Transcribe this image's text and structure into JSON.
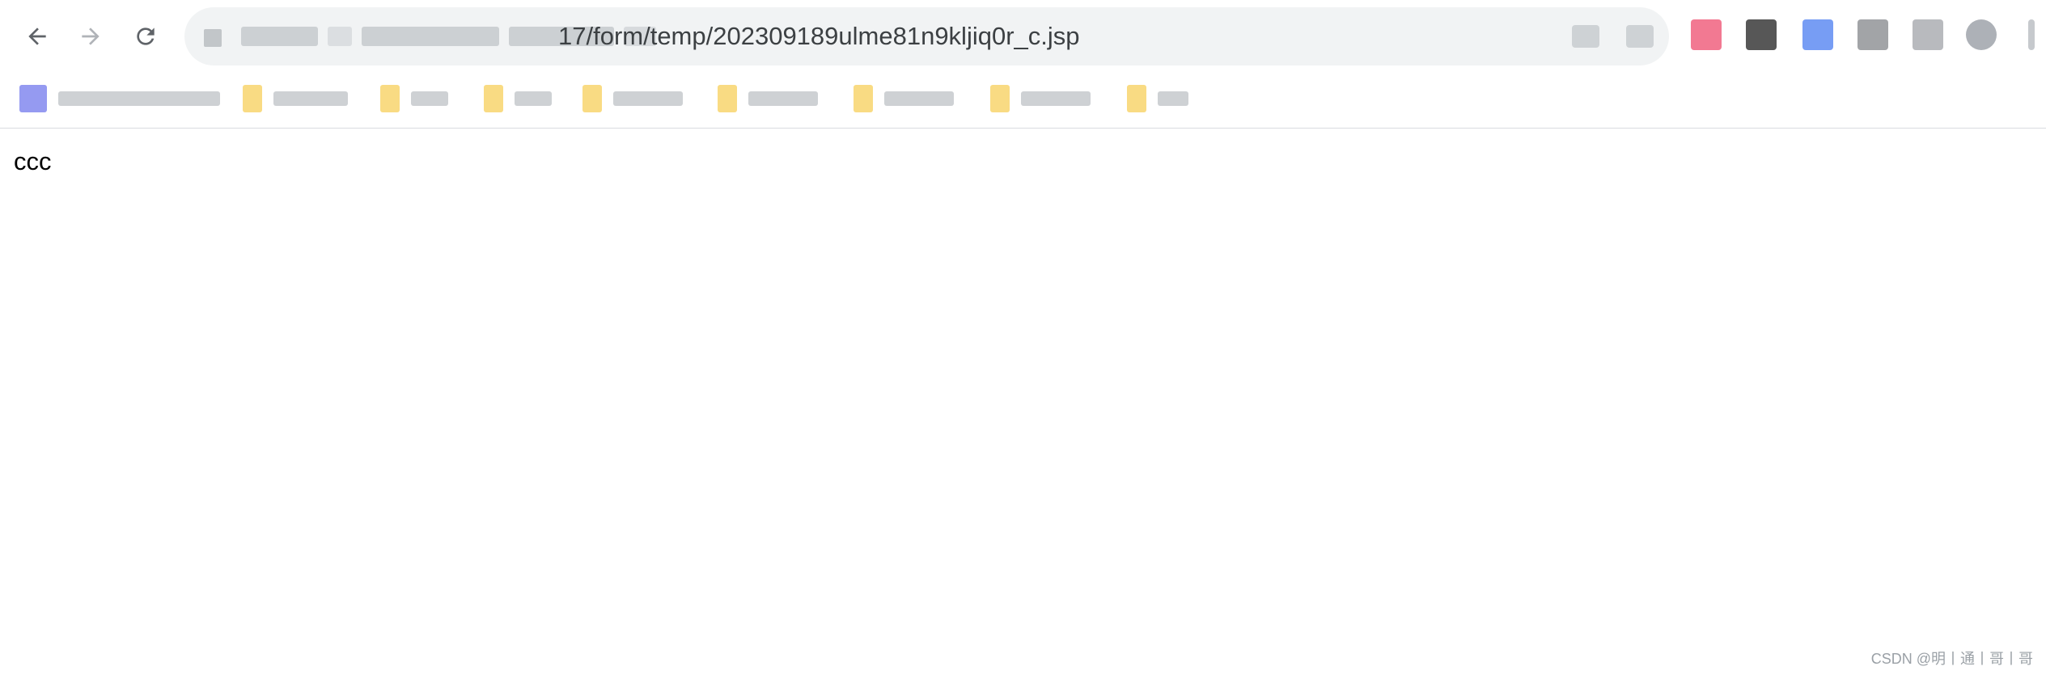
{
  "browser": {
    "toolbar": {
      "back_icon": "arrow-left-icon",
      "forward_icon": "arrow-right-icon",
      "reload_icon": "reload-icon"
    },
    "address_bar": {
      "url_visible_text": "17/form/temp/202309189ulme81n9kljiq0r_c.jsp"
    },
    "colors": {
      "toolbar_bg": "#ffffff",
      "omnibox_bg": "#f1f3f4",
      "icon": "#5f6368",
      "icon_disabled": "#b0b3b8",
      "folder": "#f8d775"
    }
  },
  "page": {
    "body_text": "ccc"
  },
  "watermark": {
    "text": "CSDN @明丨通丨哥丨哥"
  }
}
